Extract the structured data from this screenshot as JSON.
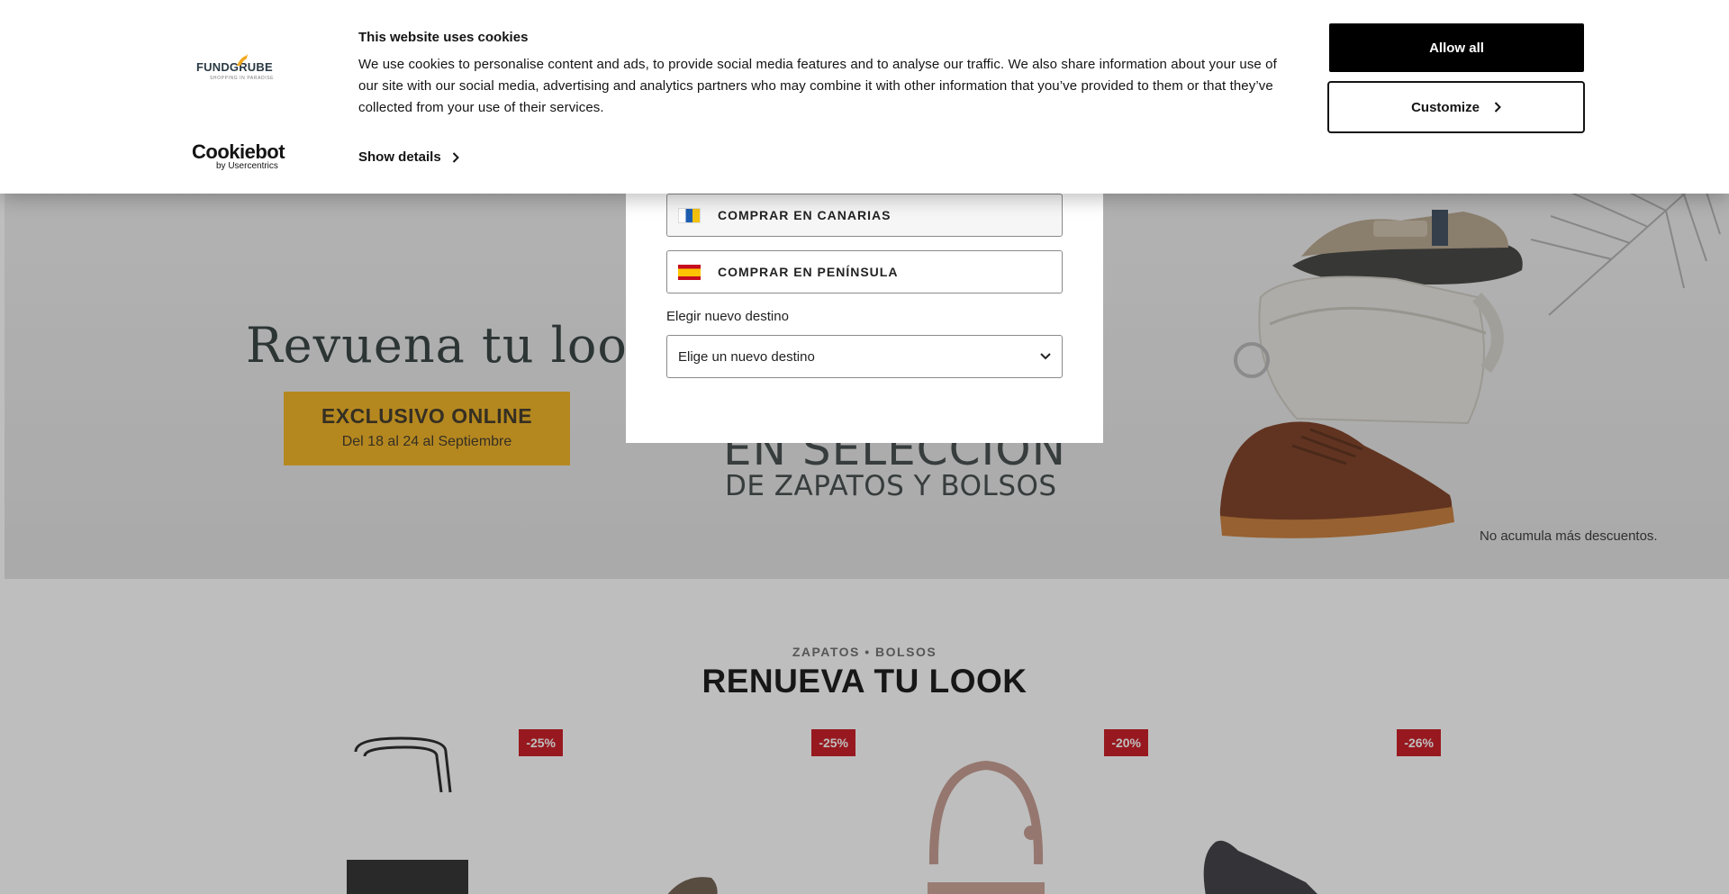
{
  "cookie_banner": {
    "title": "This website uses cookies",
    "text": "We use cookies to personalise content and ads, to provide social media features and to analyse our traffic. We also share information about your use of our site with our social media, advertising and analytics partners who may combine it with other information that you’ve provided to them or that they’ve collected from your use of their services.",
    "show_details_label": "Show details",
    "allow_all_label": "Allow all",
    "customize_label": "Customize",
    "brand_logo_text": "FUNDGRUBE",
    "brand_logo_tagline": "SHOPPING IN PARADISE",
    "cookiebot_logo_text": "Cookiebot",
    "cookiebot_logo_sub": "by Usercentrics"
  },
  "store_modal": {
    "option_canarias": "COMPRAR EN CANARIAS",
    "option_peninsula": "COMPRAR EN PENÍNSULA",
    "destination_label": "Elegir nuevo destino",
    "destination_select_value": "Elige un nuevo destino"
  },
  "hero": {
    "title": "Revuena tu look",
    "badge_line1": "EXCLUSIVO ONLINE",
    "badge_line2": "Del 18 al 24 al Septiembre",
    "mid_line1": "EN SELECCIÓN",
    "mid_line2": "DE ZAPATOS Y BOLSOS",
    "note": "No acumula más descuentos."
  },
  "section": {
    "subtitle": "ZAPATOS • BOLSOS",
    "title": "RENUEVA TU LOOK"
  },
  "products": [
    {
      "discount": "-25%"
    },
    {
      "discount": "-25%"
    },
    {
      "discount": "-20%"
    },
    {
      "discount": "-26%"
    }
  ],
  "colors": {
    "cookie_primary_button": "#000000",
    "discount_badge": "#c8141c",
    "hero_badge": "#f2b21c"
  }
}
